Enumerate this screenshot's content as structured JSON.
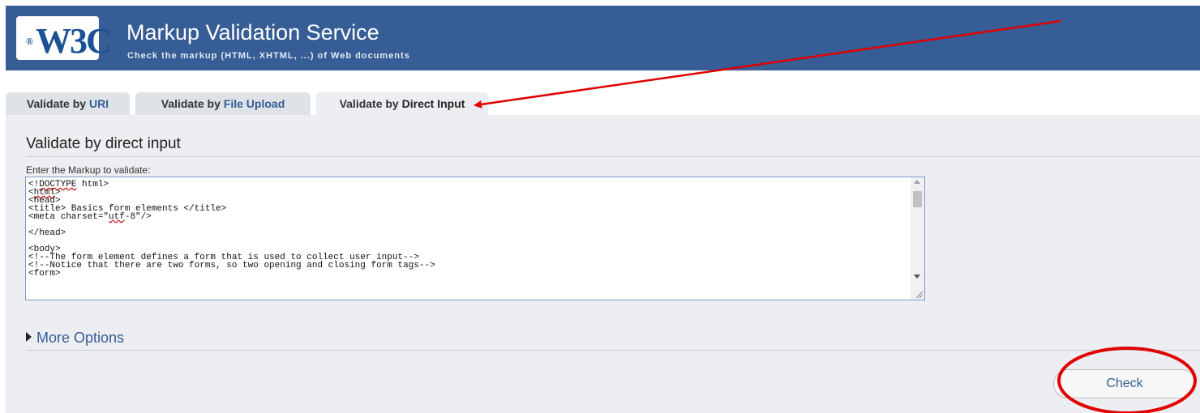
{
  "header": {
    "logo_text": "W3C",
    "logo_mark": "®",
    "title": "Markup Validation Service",
    "subtitle": "Check the markup (HTML, XHTML, ...) of Web documents"
  },
  "tabs": [
    {
      "prefix": "Validate by ",
      "label": "URI",
      "active": false
    },
    {
      "prefix": "Validate by ",
      "label": "File Upload",
      "active": false
    },
    {
      "prefix": "Validate by ",
      "label": "Direct Input",
      "active": true
    }
  ],
  "form": {
    "legend": "Validate by direct input",
    "textarea_label": "Enter the Markup to validate:",
    "textarea_lines": [
      "<!DOCTYPE html>",
      "<html>",
      "<head>",
      "<title> Basics form elements </title>",
      "<meta charset=\"utf-8\"/>",
      "",
      "</head>",
      "",
      "<body>",
      "<!--The form element defines a form that is used to collect user input-->",
      "<!--Notice that there are two forms, so two opening and closing form tags-->",
      "<form>"
    ],
    "more_options_label": "More Options",
    "check_label": "Check"
  },
  "colors": {
    "banner": "#365d95",
    "annotation": "#e00000"
  }
}
